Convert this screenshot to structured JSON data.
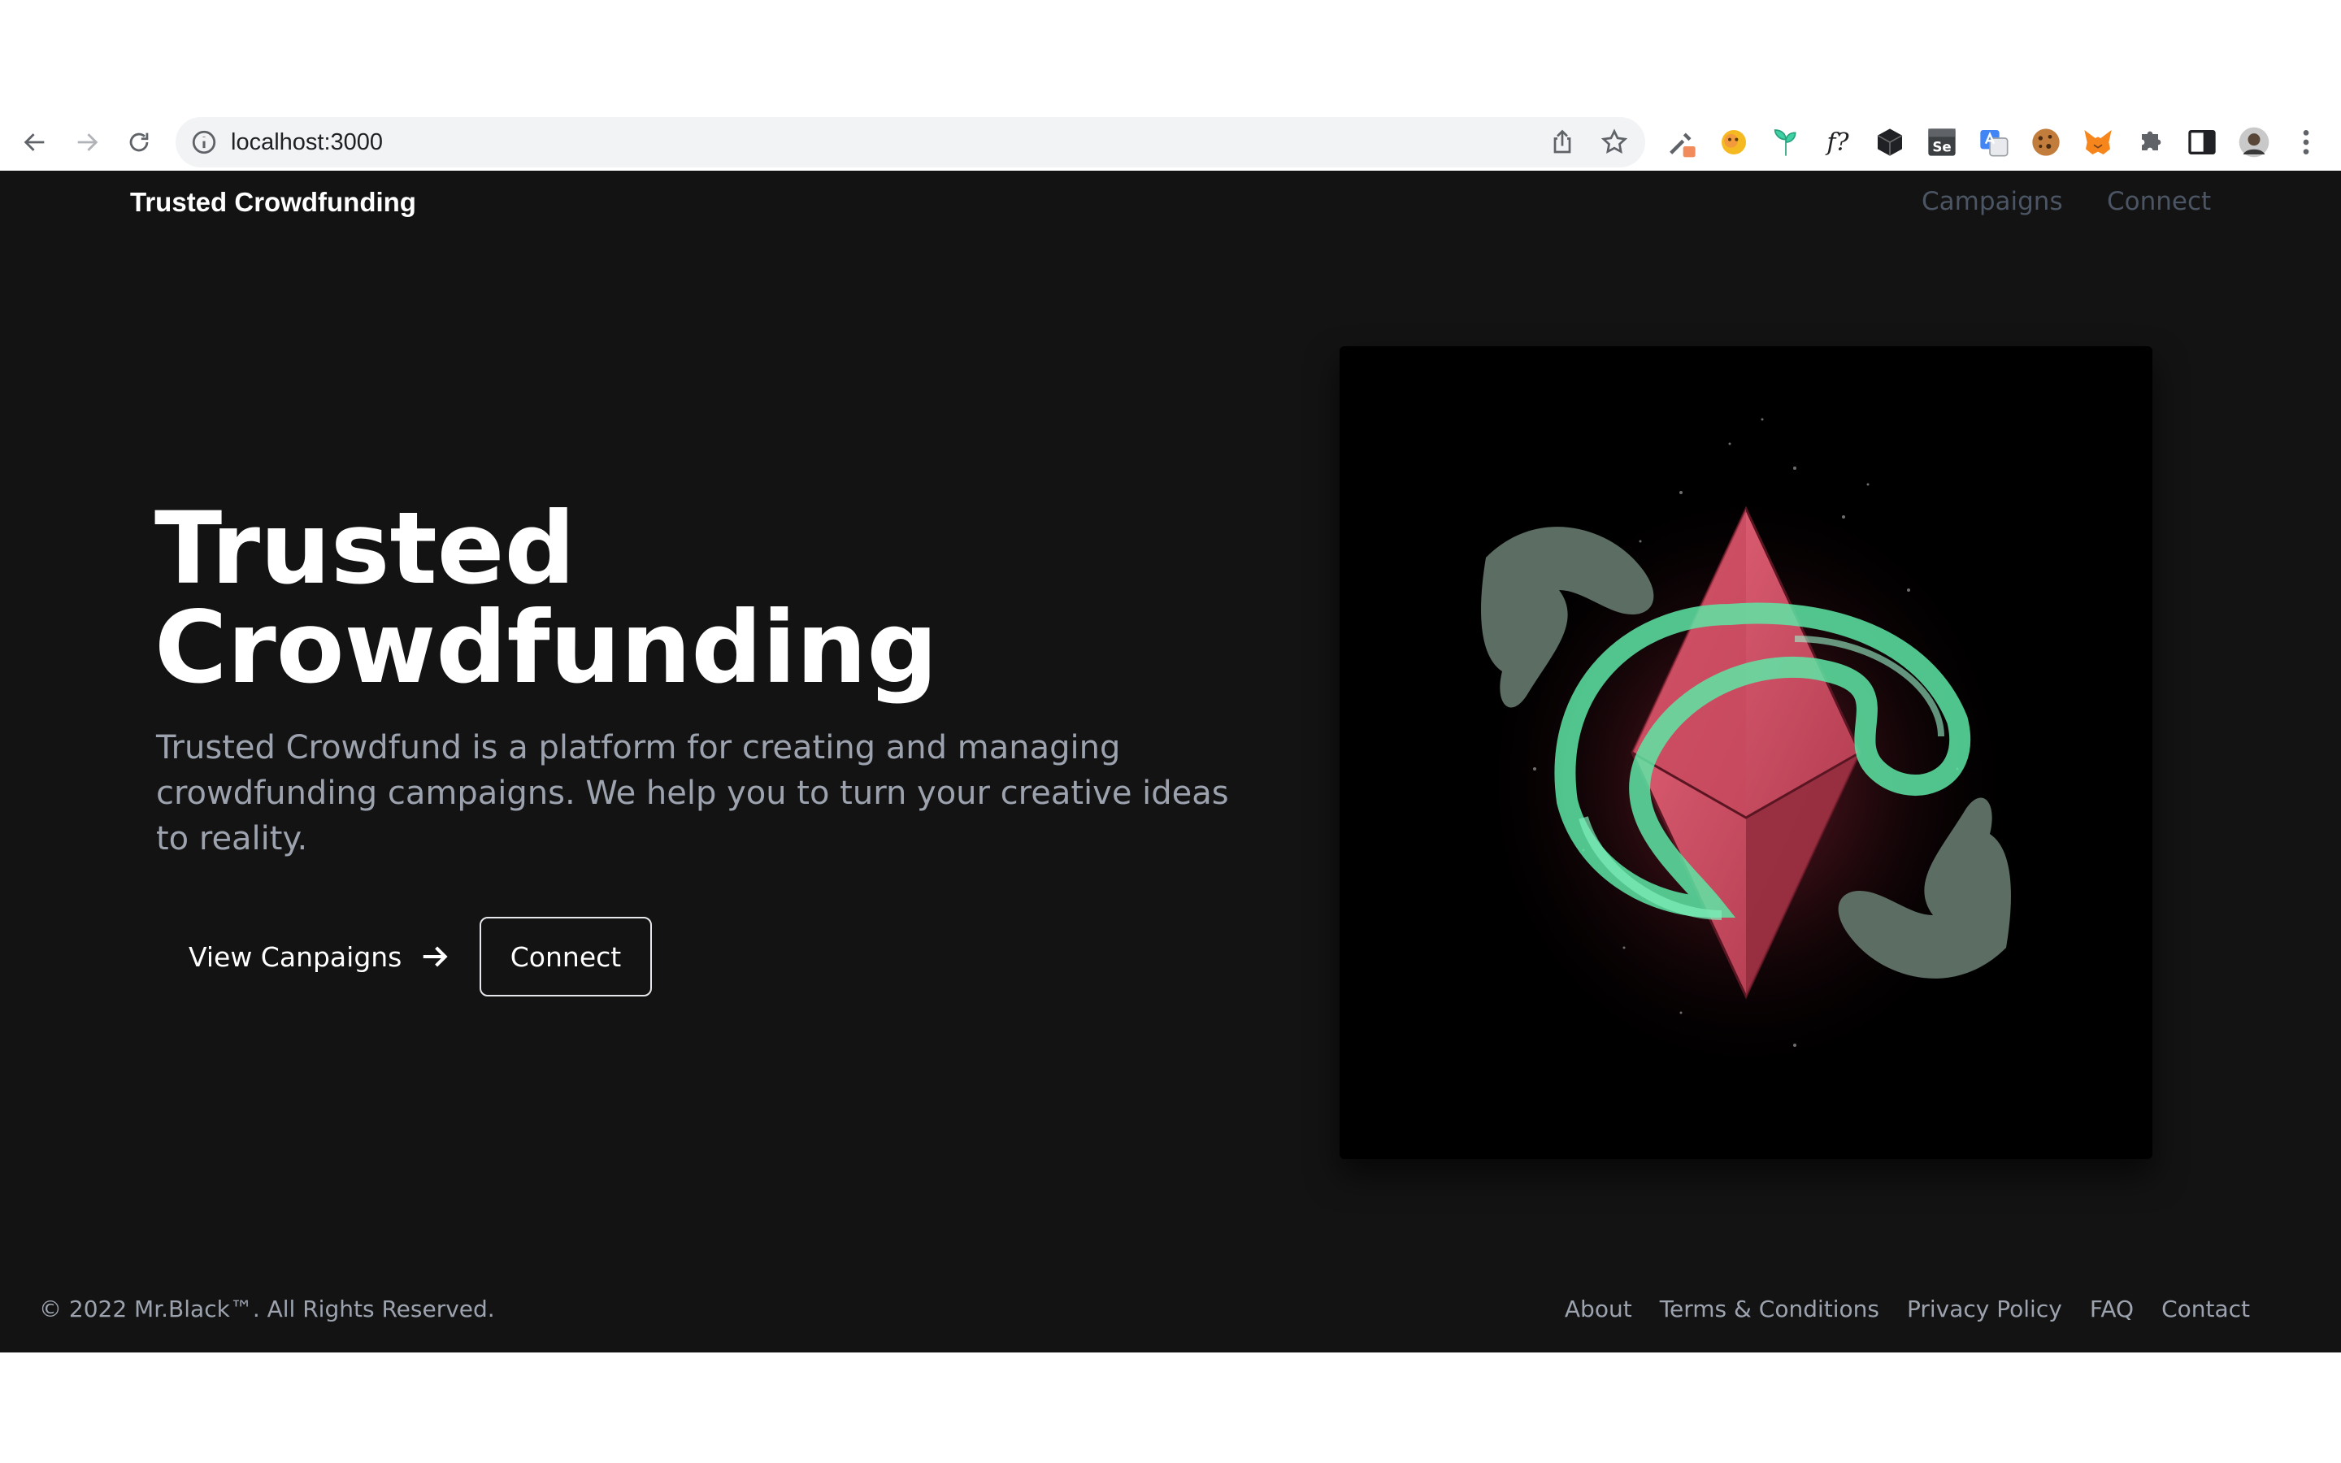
{
  "browser": {
    "url": "localhost:3000",
    "icons": {
      "back": "back-arrow-icon",
      "forward": "forward-arrow-icon",
      "reload": "reload-icon",
      "site_info": "info-icon",
      "share": "share-icon",
      "bookmark": "star-icon"
    },
    "extension_icons": [
      "eyedropper-icon",
      "emoji-icon",
      "plant-icon",
      "font-finder-icon",
      "cube-icon",
      "selenium-icon",
      "translate-icon",
      "cookie-icon",
      "metamask-fox-icon",
      "puzzle-icon",
      "side-panel-icon",
      "profile-avatar",
      "more-menu-icon"
    ],
    "font_finder_text": "f?",
    "selenium_text": "Se"
  },
  "header": {
    "brand": "Trusted Crowdfunding",
    "nav": {
      "campaigns": "Campaigns",
      "connect": "Connect"
    }
  },
  "hero": {
    "title_line1": "Trusted",
    "title_line2": "Crowdfunding",
    "subtitle": "Trusted Crowdfund is a platform for creating and managing crowdfunding campaigns. We help you to turn your creative ideas to reality.",
    "primary_button": "View Canpaigns",
    "secondary_button": "Connect",
    "image_name": "ethereum-crystal-illustration"
  },
  "footer": {
    "copyright": "© 2022 Mr.Black™. All Rights Reserved.",
    "links": {
      "about": "About",
      "terms": "Terms & Conditions",
      "privacy": "Privacy Policy",
      "faq": "FAQ",
      "contact": "Contact"
    }
  },
  "colors": {
    "page_background": "#131313",
    "muted_text": "#9ca3af",
    "nav_text": "#4b5563",
    "crystal": "#d9566b",
    "smoke": "#5ee6a6"
  }
}
